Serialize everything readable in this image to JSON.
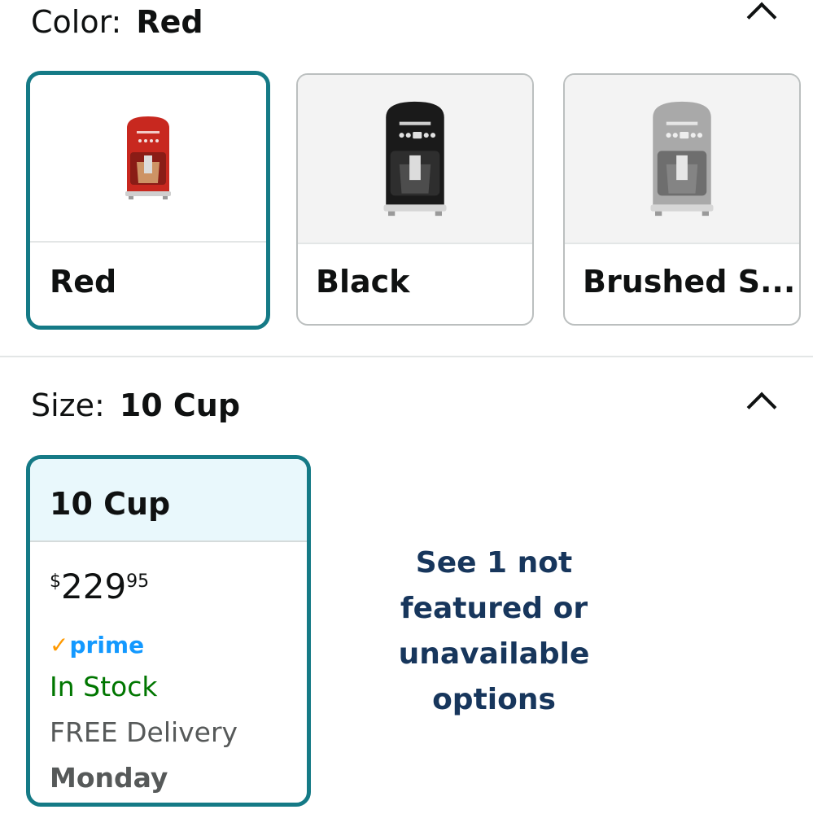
{
  "color": {
    "label": "Color:",
    "selected_value": "Red",
    "options": [
      {
        "name": "Red",
        "selected": true,
        "body_color": "#c8281f"
      },
      {
        "name": "Black",
        "selected": false,
        "body_color": "#1a1a1a"
      },
      {
        "name": "Brushed S...",
        "selected": false,
        "body_color": "#a9a9a9"
      }
    ]
  },
  "size": {
    "label": "Size:",
    "selected_value": "10 Cup",
    "card": {
      "title": "10 Cup",
      "price_symbol": "$",
      "price_whole": "229",
      "price_fraction": "95",
      "prime_check": "✓",
      "prime_label": "prime",
      "stock": "In Stock",
      "delivery": "FREE Delivery",
      "delivery_day": "Monday"
    },
    "see_more": "See 1 not featured or unavailable options"
  },
  "icons": {
    "collapse": "chevron-up-icon"
  },
  "colors": {
    "accent_border": "#157a86",
    "selected_header_bg": "#e9f8fc",
    "in_stock": "#007600",
    "prime_blue": "#1399ff",
    "prime_check": "#ff9900",
    "link_dark_blue": "#17365c"
  }
}
